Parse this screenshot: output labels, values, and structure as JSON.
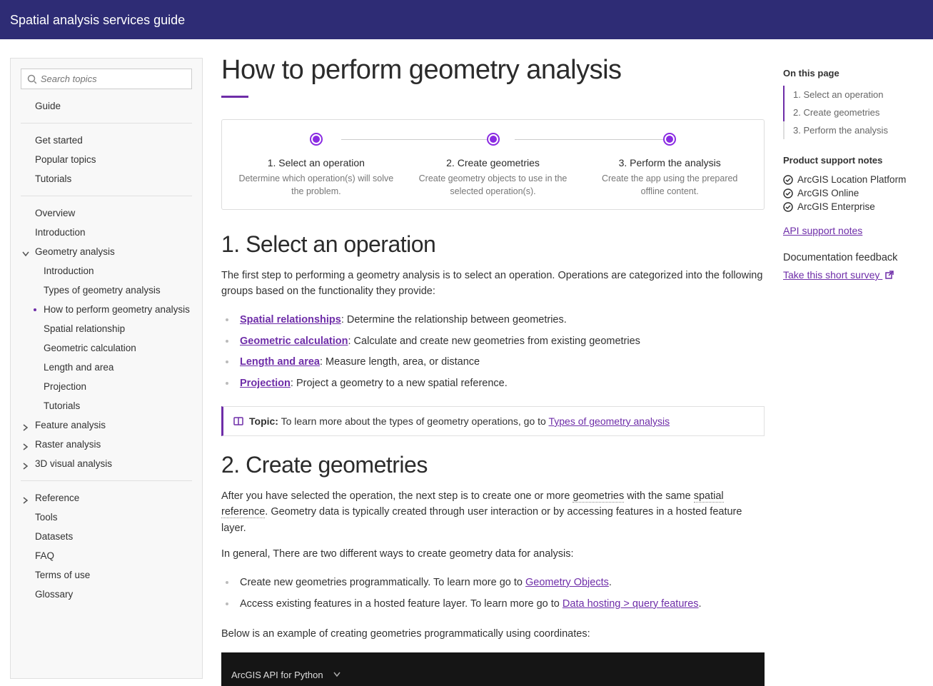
{
  "header": {
    "title": "Spatial analysis services guide"
  },
  "sidebar": {
    "search_placeholder": "Search topics",
    "guide_label": "Guide",
    "group_intro": [
      "Get started",
      "Popular topics",
      "Tutorials"
    ],
    "group_main": {
      "overview": "Overview",
      "introduction": "Introduction",
      "geometry_analysis": {
        "label": "Geometry analysis",
        "children": [
          "Introduction",
          "Types of geometry analysis",
          "How to perform geometry analysis",
          "Spatial relationship",
          "Geometric calculation",
          "Length and area",
          "Projection",
          "Tutorials"
        ],
        "active_index": 2
      },
      "feature_analysis": "Feature analysis",
      "raster_analysis": "Raster analysis",
      "visual_3d": "3D visual analysis"
    },
    "group_ref": [
      "Reference",
      "Tools",
      "Datasets",
      "FAQ",
      "Terms of use",
      "Glossary"
    ]
  },
  "page": {
    "title": "How to perform geometry analysis",
    "steps": [
      {
        "title": "1. Select an operation",
        "desc": "Determine which operation(s) will solve the problem."
      },
      {
        "title": "2. Create geometries",
        "desc": "Create geometry objects to use in the selected operation(s)."
      },
      {
        "title": "3. Perform the analysis",
        "desc": "Create the app using the prepared offline content."
      }
    ],
    "s1": {
      "heading": "1. Select an operation",
      "intro": "The first step to performing a geometry analysis is to select an operation. Operations are categorized into the following groups based on the functionality they provide:",
      "items": [
        {
          "link": "Spatial relationships",
          "rest": ": Determine the relationship between geometries."
        },
        {
          "link": "Geometric calculation",
          "rest": ": Calculate and create new geometries from existing geometries"
        },
        {
          "link": "Length and area",
          "rest": ": Measure length, area, or distance"
        },
        {
          "link": "Projection",
          "rest": ": Project a geometry to a new spatial reference."
        }
      ],
      "callout_prefix": "Topic:",
      "callout_text": " To learn more about the types of geometry operations, go to ",
      "callout_link": "Types of geometry analysis"
    },
    "s2": {
      "heading": "2. Create geometries",
      "p1a": "After you have selected the operation, the next step is to create one or more ",
      "p1_term1": "geometries",
      "p1b": " with the same ",
      "p1_term2": "spatial reference",
      "p1c": ". Geometry data is typically created through user interaction or by accessing features in a hosted feature layer.",
      "p2": "In general, There are two different ways to create geometry data for analysis:",
      "items": [
        {
          "pre": "Create new geometries programmatically. To learn more go to ",
          "link": "Geometry Objects",
          "post": "."
        },
        {
          "pre": "Access existing features in a hosted feature layer. To learn more go to ",
          "link": "Data hosting > query features",
          "post": "."
        }
      ],
      "p3": "Below is an example of creating geometries programmatically using coordinates:"
    },
    "code_tab": "ArcGIS API for Python"
  },
  "right": {
    "on_this_page": "On this page",
    "toc": [
      "1. Select an operation",
      "2. Create geometries",
      "3. Perform the analysis"
    ],
    "support_h": "Product support notes",
    "support": [
      "ArcGIS Location Platform",
      "ArcGIS Online",
      "ArcGIS Enterprise"
    ],
    "api_link": "API support notes",
    "feedback_h": "Documentation feedback",
    "feedback_link": "Take this short survey"
  }
}
